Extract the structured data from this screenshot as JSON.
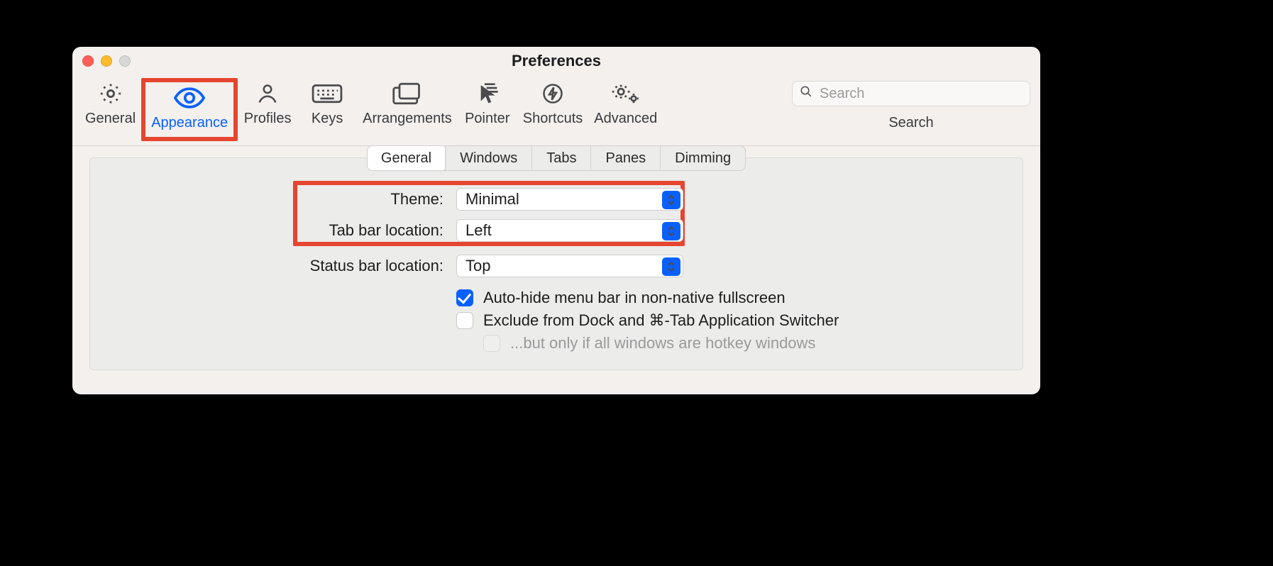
{
  "window": {
    "title": "Preferences"
  },
  "toolbar": {
    "items": [
      {
        "label": "General"
      },
      {
        "label": "Appearance"
      },
      {
        "label": "Profiles"
      },
      {
        "label": "Keys"
      },
      {
        "label": "Arrangements"
      },
      {
        "label": "Pointer"
      },
      {
        "label": "Shortcuts"
      },
      {
        "label": "Advanced"
      }
    ],
    "active_index": 1
  },
  "search": {
    "placeholder": "Search",
    "label": "Search"
  },
  "subtabs": {
    "items": [
      "General",
      "Windows",
      "Tabs",
      "Panes",
      "Dimming"
    ],
    "selected_index": 0
  },
  "form": {
    "theme_label": "Theme:",
    "theme_value": "Minimal",
    "tabbar_label": "Tab bar location:",
    "tabbar_value": "Left",
    "statusbar_label": "Status bar location:",
    "statusbar_value": "Top"
  },
  "checks": {
    "autohide_label": "Auto-hide menu bar in non-native fullscreen",
    "autohide_checked": true,
    "exclude_label": "Exclude from Dock and ⌘-Tab Application Switcher",
    "exclude_checked": false,
    "only_hotkey_label": "...but only if all windows are hotkey windows",
    "only_hotkey_enabled": false
  },
  "highlights": {
    "appearance_toolbar": true,
    "theme_and_tabbar_rows": true
  }
}
